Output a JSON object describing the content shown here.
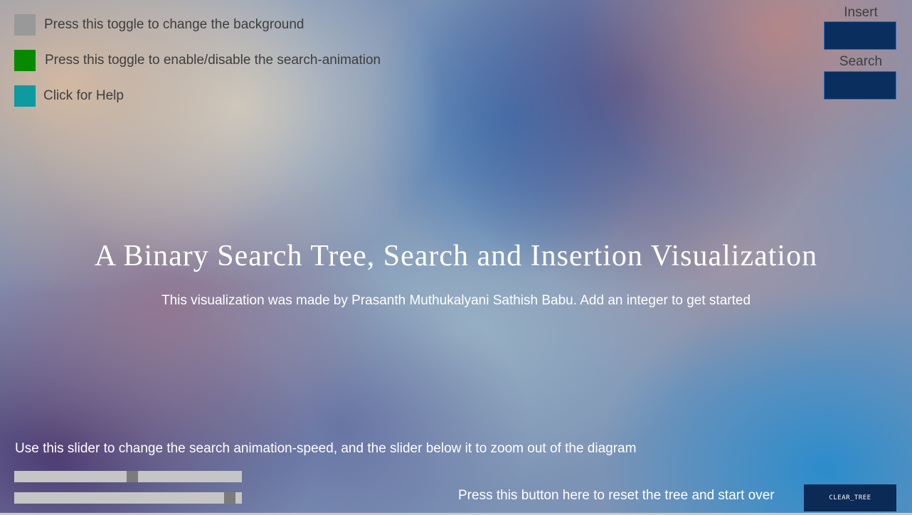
{
  "toggles": [
    {
      "label": "Press this toggle to change the background",
      "color": "#999999"
    },
    {
      "label": "Press this toggle to enable/disable the search-animation",
      "color": "#078a00"
    },
    {
      "label": "Click for Help",
      "color": "#0e9aa0"
    }
  ],
  "insert": {
    "label": "Insert",
    "value": ""
  },
  "search": {
    "label": "Search",
    "value": ""
  },
  "title": "A Binary Search Tree, Search and Insertion Visualization",
  "subtitle": "This visualization was made by Prasanth Muthukalyani Sathish Babu. Add an integer to get started",
  "slider_help": "Use this slider to change the search animation-speed, and the slider below it to zoom out of the diagram",
  "sliders": {
    "animation_speed": {
      "value_fraction": 0.52
    },
    "zoom": {
      "value_fraction": 0.97
    }
  },
  "reset_help": "Press this button here to reset the tree and start over",
  "clear_button": {
    "label": "CLEAR_TREE"
  },
  "colors": {
    "input_bg": "#0a2f5e",
    "input_border": "#2a6fd0",
    "button_bg": "#0b2a55",
    "slider_track": "#c5c5c5",
    "slider_thumb": "#7b7b7b"
  }
}
